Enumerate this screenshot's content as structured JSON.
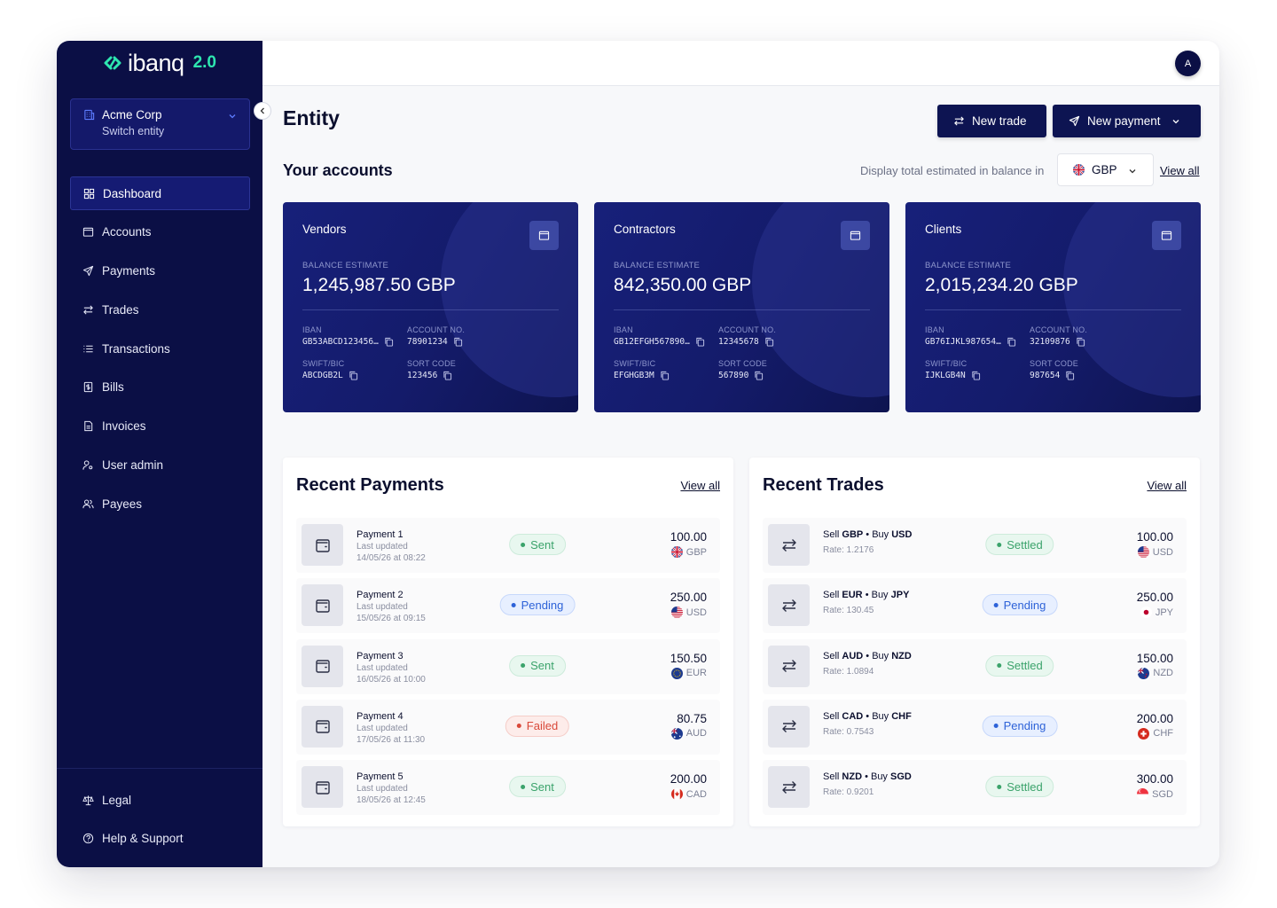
{
  "brand": {
    "name": "ibanq",
    "version": "2.0"
  },
  "entity": {
    "name": "Acme Corp",
    "switch_label": "Switch entity"
  },
  "nav": {
    "items": [
      {
        "label": "Dashboard",
        "icon": "dashboard-icon",
        "active": true
      },
      {
        "label": "Accounts",
        "icon": "wallet-icon"
      },
      {
        "label": "Payments",
        "icon": "send-icon"
      },
      {
        "label": "Trades",
        "icon": "arrows-icon"
      },
      {
        "label": "Transactions",
        "icon": "list-icon"
      },
      {
        "label": "Bills",
        "icon": "bill-icon"
      },
      {
        "label": "Invoices",
        "icon": "document-icon"
      },
      {
        "label": "User admin",
        "icon": "user-key-icon"
      },
      {
        "label": "Payees",
        "icon": "users-icon"
      }
    ],
    "bottom": [
      {
        "label": "Legal",
        "icon": "scales-icon"
      },
      {
        "label": "Help & Support",
        "icon": "help-icon"
      }
    ]
  },
  "user": {
    "initial": "A"
  },
  "page": {
    "title": "Entity",
    "new_trade": "New trade",
    "new_payment": "New payment",
    "accounts_title": "Your accounts",
    "display_label": "Display total estimated in balance in",
    "display_currency": "GBP",
    "view_all": "View all"
  },
  "accounts": [
    {
      "name": "Vendors",
      "balance_label": "BALANCE ESTIMATE",
      "balance": "1,245,987.50 GBP",
      "iban_label": "IBAN",
      "iban": "GB53ABCD123456…",
      "acc_label": "ACCOUNT NO.",
      "acc_no": "78901234",
      "swift_label": "SWIFT/BIC",
      "swift": "ABCDGB2L",
      "sort_label": "SORT CODE",
      "sort": "123456"
    },
    {
      "name": "Contractors",
      "balance_label": "BALANCE ESTIMATE",
      "balance": "842,350.00 GBP",
      "iban_label": "IBAN",
      "iban": "GB12EFGH567890…",
      "acc_label": "ACCOUNT NO.",
      "acc_no": "12345678",
      "swift_label": "SWIFT/BIC",
      "swift": "EFGHGB3M",
      "sort_label": "SORT CODE",
      "sort": "567890"
    },
    {
      "name": "Clients",
      "balance_label": "BALANCE ESTIMATE",
      "balance": "2,015,234.20 GBP",
      "iban_label": "IBAN",
      "iban": "GB76IJKL987654…",
      "acc_label": "ACCOUNT NO.",
      "acc_no": "32109876",
      "swift_label": "SWIFT/BIC",
      "swift": "IJKLGB4N",
      "sort_label": "SORT CODE",
      "sort": "987654"
    }
  ],
  "payments": {
    "title": "Recent Payments",
    "view_all": "View all",
    "rows": [
      {
        "name": "Payment 1",
        "updated_label": "Last updated",
        "updated": "14/05/26 at 08:22",
        "status": "Sent",
        "status_kind": "sent",
        "amount": "100.00",
        "currency": "GBP",
        "flag": "gb"
      },
      {
        "name": "Payment 2",
        "updated_label": "Last updated",
        "updated": "15/05/26 at 09:15",
        "status": "Pending",
        "status_kind": "pending",
        "amount": "250.00",
        "currency": "USD",
        "flag": "us"
      },
      {
        "name": "Payment 3",
        "updated_label": "Last updated",
        "updated": "16/05/26 at 10:00",
        "status": "Sent",
        "status_kind": "sent",
        "amount": "150.50",
        "currency": "EUR",
        "flag": "eu"
      },
      {
        "name": "Payment 4",
        "updated_label": "Last updated",
        "updated": "17/05/26 at 11:30",
        "status": "Failed",
        "status_kind": "failed",
        "amount": "80.75",
        "currency": "AUD",
        "flag": "au"
      },
      {
        "name": "Payment 5",
        "updated_label": "Last updated",
        "updated": "18/05/26 at 12:45",
        "status": "Sent",
        "status_kind": "sent",
        "amount": "200.00",
        "currency": "CAD",
        "flag": "ca"
      }
    ]
  },
  "trades": {
    "title": "Recent Trades",
    "view_all": "View all",
    "rows": [
      {
        "sell": "GBP",
        "buy": "USD",
        "rate": "Rate: 1.2176",
        "status": "Settled",
        "status_kind": "sent",
        "amount": "100.00",
        "currency": "USD",
        "flag": "us"
      },
      {
        "sell": "EUR",
        "buy": "JPY",
        "rate": "Rate: 130.45",
        "status": "Pending",
        "status_kind": "pending",
        "amount": "250.00",
        "currency": "JPY",
        "flag": "jp"
      },
      {
        "sell": "AUD",
        "buy": "NZD",
        "rate": "Rate: 1.0894",
        "status": "Settled",
        "status_kind": "sent",
        "amount": "150.00",
        "currency": "NZD",
        "flag": "nz"
      },
      {
        "sell": "CAD",
        "buy": "CHF",
        "rate": "Rate: 0.7543",
        "status": "Pending",
        "status_kind": "pending",
        "amount": "200.00",
        "currency": "CHF",
        "flag": "ch"
      },
      {
        "sell": "NZD",
        "buy": "SGD",
        "rate": "Rate: 0.9201",
        "status": "Settled",
        "status_kind": "sent",
        "amount": "300.00",
        "currency": "SGD",
        "flag": "sg"
      }
    ]
  },
  "colors": {
    "sidebar": "#0b0f45",
    "brand_accent": "#2ee6b0",
    "primary_button": "#0d1452",
    "sent": "#3ba36b",
    "pending": "#2d62d8",
    "failed": "#d9493a"
  }
}
